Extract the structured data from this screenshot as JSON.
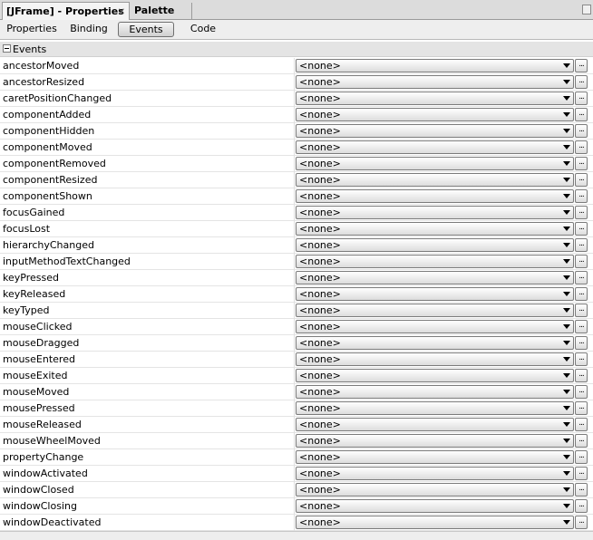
{
  "tabs": {
    "active_label": "[JFrame] - Properties",
    "close_glyph": "✕",
    "inactive_label": "Palette"
  },
  "toolbar": {
    "properties_label": "Properties",
    "binding_label": "Binding",
    "events_label": "Events",
    "code_label": "Code",
    "selected": "Events"
  },
  "category": {
    "label": "Events",
    "state": "expanded"
  },
  "events": [
    {
      "name": "ancestorMoved",
      "value": "<none>"
    },
    {
      "name": "ancestorResized",
      "value": "<none>"
    },
    {
      "name": "caretPositionChanged",
      "value": "<none>"
    },
    {
      "name": "componentAdded",
      "value": "<none>"
    },
    {
      "name": "componentHidden",
      "value": "<none>"
    },
    {
      "name": "componentMoved",
      "value": "<none>"
    },
    {
      "name": "componentRemoved",
      "value": "<none>"
    },
    {
      "name": "componentResized",
      "value": "<none>"
    },
    {
      "name": "componentShown",
      "value": "<none>"
    },
    {
      "name": "focusGained",
      "value": "<none>"
    },
    {
      "name": "focusLost",
      "value": "<none>"
    },
    {
      "name": "hierarchyChanged",
      "value": "<none>"
    },
    {
      "name": "inputMethodTextChanged",
      "value": "<none>"
    },
    {
      "name": "keyPressed",
      "value": "<none>"
    },
    {
      "name": "keyReleased",
      "value": "<none>"
    },
    {
      "name": "keyTyped",
      "value": "<none>"
    },
    {
      "name": "mouseClicked",
      "value": "<none>"
    },
    {
      "name": "mouseDragged",
      "value": "<none>"
    },
    {
      "name": "mouseEntered",
      "value": "<none>"
    },
    {
      "name": "mouseExited",
      "value": "<none>"
    },
    {
      "name": "mouseMoved",
      "value": "<none>"
    },
    {
      "name": "mousePressed",
      "value": "<none>"
    },
    {
      "name": "mouseReleased",
      "value": "<none>"
    },
    {
      "name": "mouseWheelMoved",
      "value": "<none>"
    },
    {
      "name": "propertyChange",
      "value": "<none>"
    },
    {
      "name": "windowActivated",
      "value": "<none>"
    },
    {
      "name": "windowClosed",
      "value": "<none>"
    },
    {
      "name": "windowClosing",
      "value": "<none>"
    },
    {
      "name": "windowDeactivated",
      "value": "<none>"
    }
  ],
  "ellipsis_label": "...",
  "colors": {
    "tabstrip_bg": "#dcdcdc",
    "toolbar_bg": "#eeeeee",
    "category_bg": "#e4e4e4",
    "row_border": "#e4e4e4"
  }
}
